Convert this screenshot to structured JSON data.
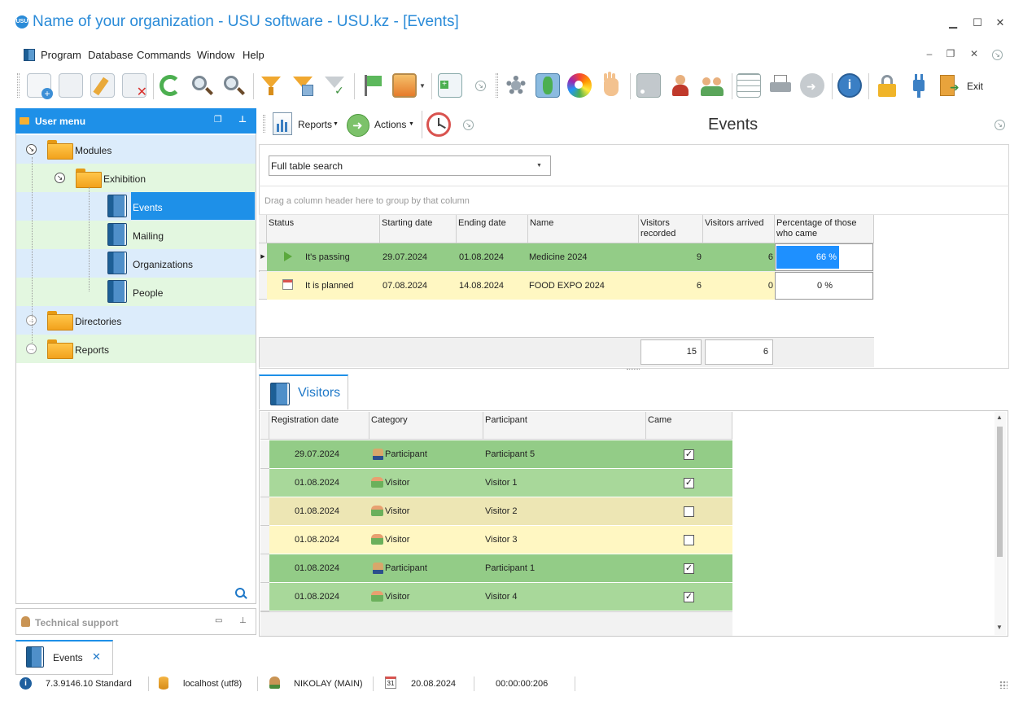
{
  "window": {
    "title": "Name of your organization - USU software - USU.kz - [Events]",
    "logo_text": "USU",
    "minimize": "▁",
    "maximize": "☐",
    "close": "✕"
  },
  "menu": {
    "items": [
      "Program",
      "Database",
      "Commands",
      "Window",
      "Help"
    ],
    "mdi_minimize": "‒",
    "mdi_restore": "❐",
    "mdi_close": "✕"
  },
  "toolbar": {
    "exit_label": "Exit"
  },
  "user_menu": {
    "title": "User menu",
    "tree": {
      "modules": "Modules",
      "exhibition": "Exhibition",
      "events": "Events",
      "mailing": "Mailing",
      "organizations": "Organizations",
      "people": "People",
      "directories": "Directories",
      "reports": "Reports"
    }
  },
  "tech_support": {
    "label": "Technical support"
  },
  "content": {
    "reports_btn": "Reports",
    "actions_btn": "Actions",
    "heading": "Events",
    "search_placeholder": "Full table search",
    "group_hint": "Drag a column header here to group by that column"
  },
  "events_table": {
    "columns": {
      "status": "Status",
      "start": "Starting date",
      "end": "Ending date",
      "name": "Name",
      "recorded": "Visitors recorded",
      "arrived": "Visitors arrived",
      "percent": "Percentage of those who came"
    },
    "rows": [
      {
        "status": "It's passing",
        "start": "29.07.2024",
        "end": "01.08.2024",
        "name": "Medicine 2024",
        "recorded": "9",
        "arrived": "6",
        "percent": "66 %",
        "percent_value": 66
      },
      {
        "status": "It is planned",
        "start": "07.08.2024",
        "end": "14.08.2024",
        "name": "FOOD EXPO 2024",
        "recorded": "6",
        "arrived": "0",
        "percent": "0 %",
        "percent_value": 0
      }
    ],
    "totals": {
      "recorded": "15",
      "arrived": "6"
    }
  },
  "visitors": {
    "tab_label": "Visitors",
    "columns": {
      "reg_date": "Registration date",
      "category": "Category",
      "participant": "Participant",
      "came": "Came"
    },
    "rows": [
      {
        "reg_date": "29.07.2024",
        "category": "Participant",
        "participant": "Participant 5",
        "came": true
      },
      {
        "reg_date": "01.08.2024",
        "category": "Visitor",
        "participant": "Visitor 1",
        "came": true
      },
      {
        "reg_date": "01.08.2024",
        "category": "Visitor",
        "participant": "Visitor 2",
        "came": false
      },
      {
        "reg_date": "01.08.2024",
        "category": "Visitor",
        "participant": "Visitor 3",
        "came": false
      },
      {
        "reg_date": "01.08.2024",
        "category": "Participant",
        "participant": "Participant 1",
        "came": true
      },
      {
        "reg_date": "01.08.2024",
        "category": "Visitor",
        "participant": "Visitor 4",
        "came": true
      }
    ]
  },
  "doc_tab": {
    "label": "Events",
    "close": "✕"
  },
  "status_bar": {
    "version": "7.3.9146.10 Standard",
    "db": "localhost (utf8)",
    "user": "NIKOLAY (MAIN)",
    "date": "20.08.2024",
    "timer": "00:00:00:206",
    "calendar_day": "31"
  },
  "colors": {
    "accent": "#1e90e8",
    "row_green": "#a8d89a",
    "row_green_dark": "#93cc87",
    "row_yellow": "#fff7c2",
    "row_khaki": "#ede6b4",
    "tree_blue": "#dcecfb",
    "tree_green": "#e3f7e0"
  }
}
